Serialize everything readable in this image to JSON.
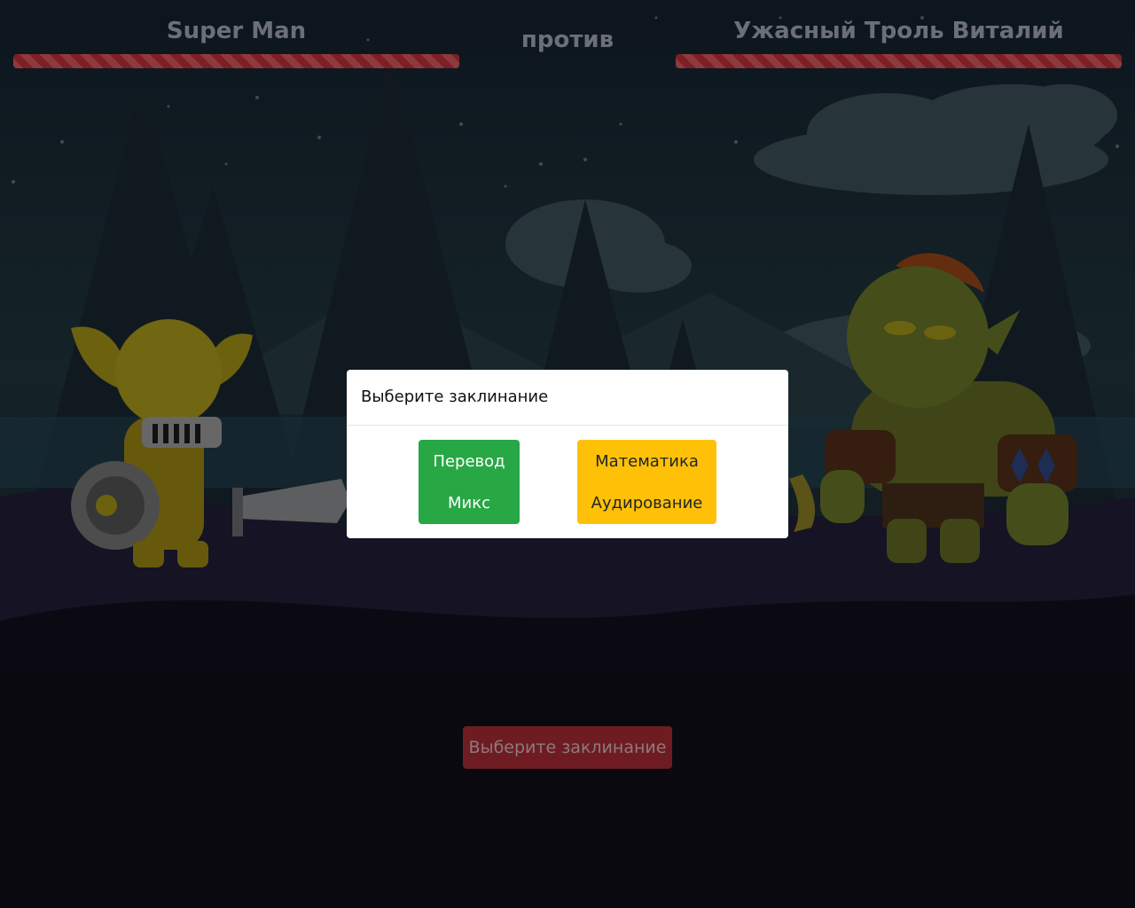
{
  "hud": {
    "player_name": "Super Man",
    "versus_label": "против",
    "enemy_name": "Ужасный Троль Виталий",
    "player_health": 1.0,
    "enemy_health": 1.0
  },
  "bottom_button": {
    "label": "Выберите заклинание"
  },
  "modal": {
    "title": "Выберите заклинание",
    "spells": [
      {
        "line1": "Перевод",
        "line2": "Микс"
      },
      {
        "line1": "Математика",
        "line2": "Аудирование"
      }
    ]
  },
  "colors": {
    "health_bar": "#7d1f24",
    "spell_green": "#28a745",
    "spell_yellow": "#ffc107",
    "bottom_button": "#6e1c22"
  }
}
